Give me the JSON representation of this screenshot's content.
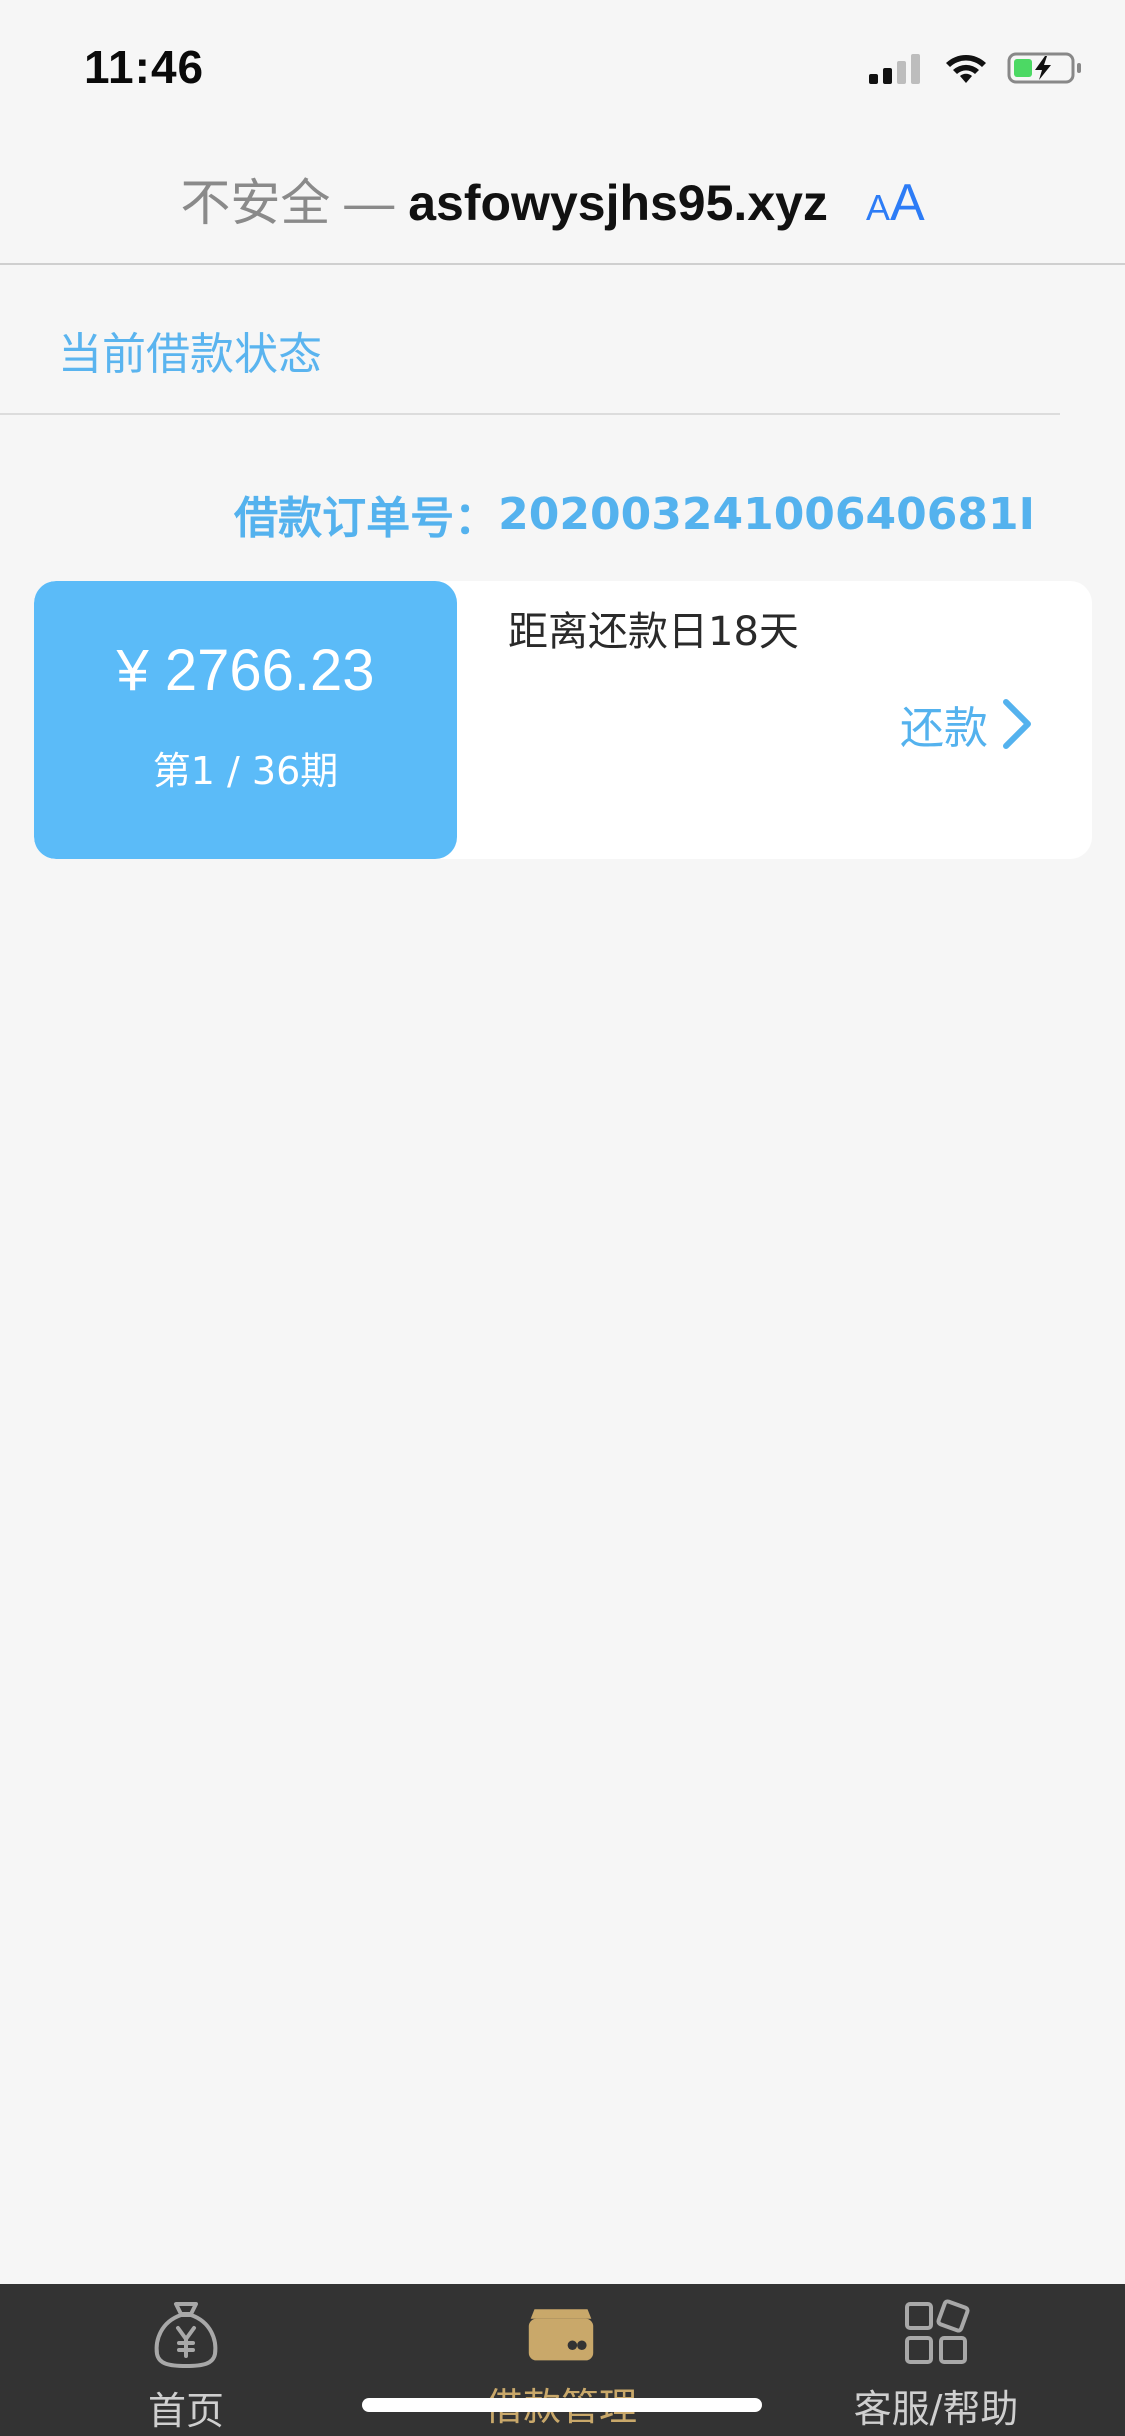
{
  "status_bar": {
    "time": "11:46",
    "icons": [
      "signal-icon",
      "wifi-icon",
      "battery-charging-icon"
    ]
  },
  "address_bar": {
    "security_label": "不安全 —",
    "host": "asfowysjhs95.xyz",
    "text_size_small": "A",
    "text_size_big": "A"
  },
  "section": {
    "title": "当前借款状态"
  },
  "order": {
    "label": "借款订单号：",
    "number": "20200324100640681I"
  },
  "loan_card": {
    "amount": "¥ 2766.23",
    "period": "第1 / 36期",
    "days_left": "距离还款日18天",
    "repay_label": "还款"
  },
  "tab_bar": {
    "tabs": [
      {
        "label": "首页",
        "icon": "money-bag-icon",
        "active": false
      },
      {
        "label": "借款管理",
        "icon": "wallet-icon",
        "active": true
      },
      {
        "label": "客服/帮助",
        "icon": "grid-icon",
        "active": false
      }
    ]
  },
  "colors": {
    "accent": "#5bbbf8",
    "link": "#54b2ee",
    "tab_active": "#c9a86a",
    "tab_bar_bg": "#333333"
  }
}
